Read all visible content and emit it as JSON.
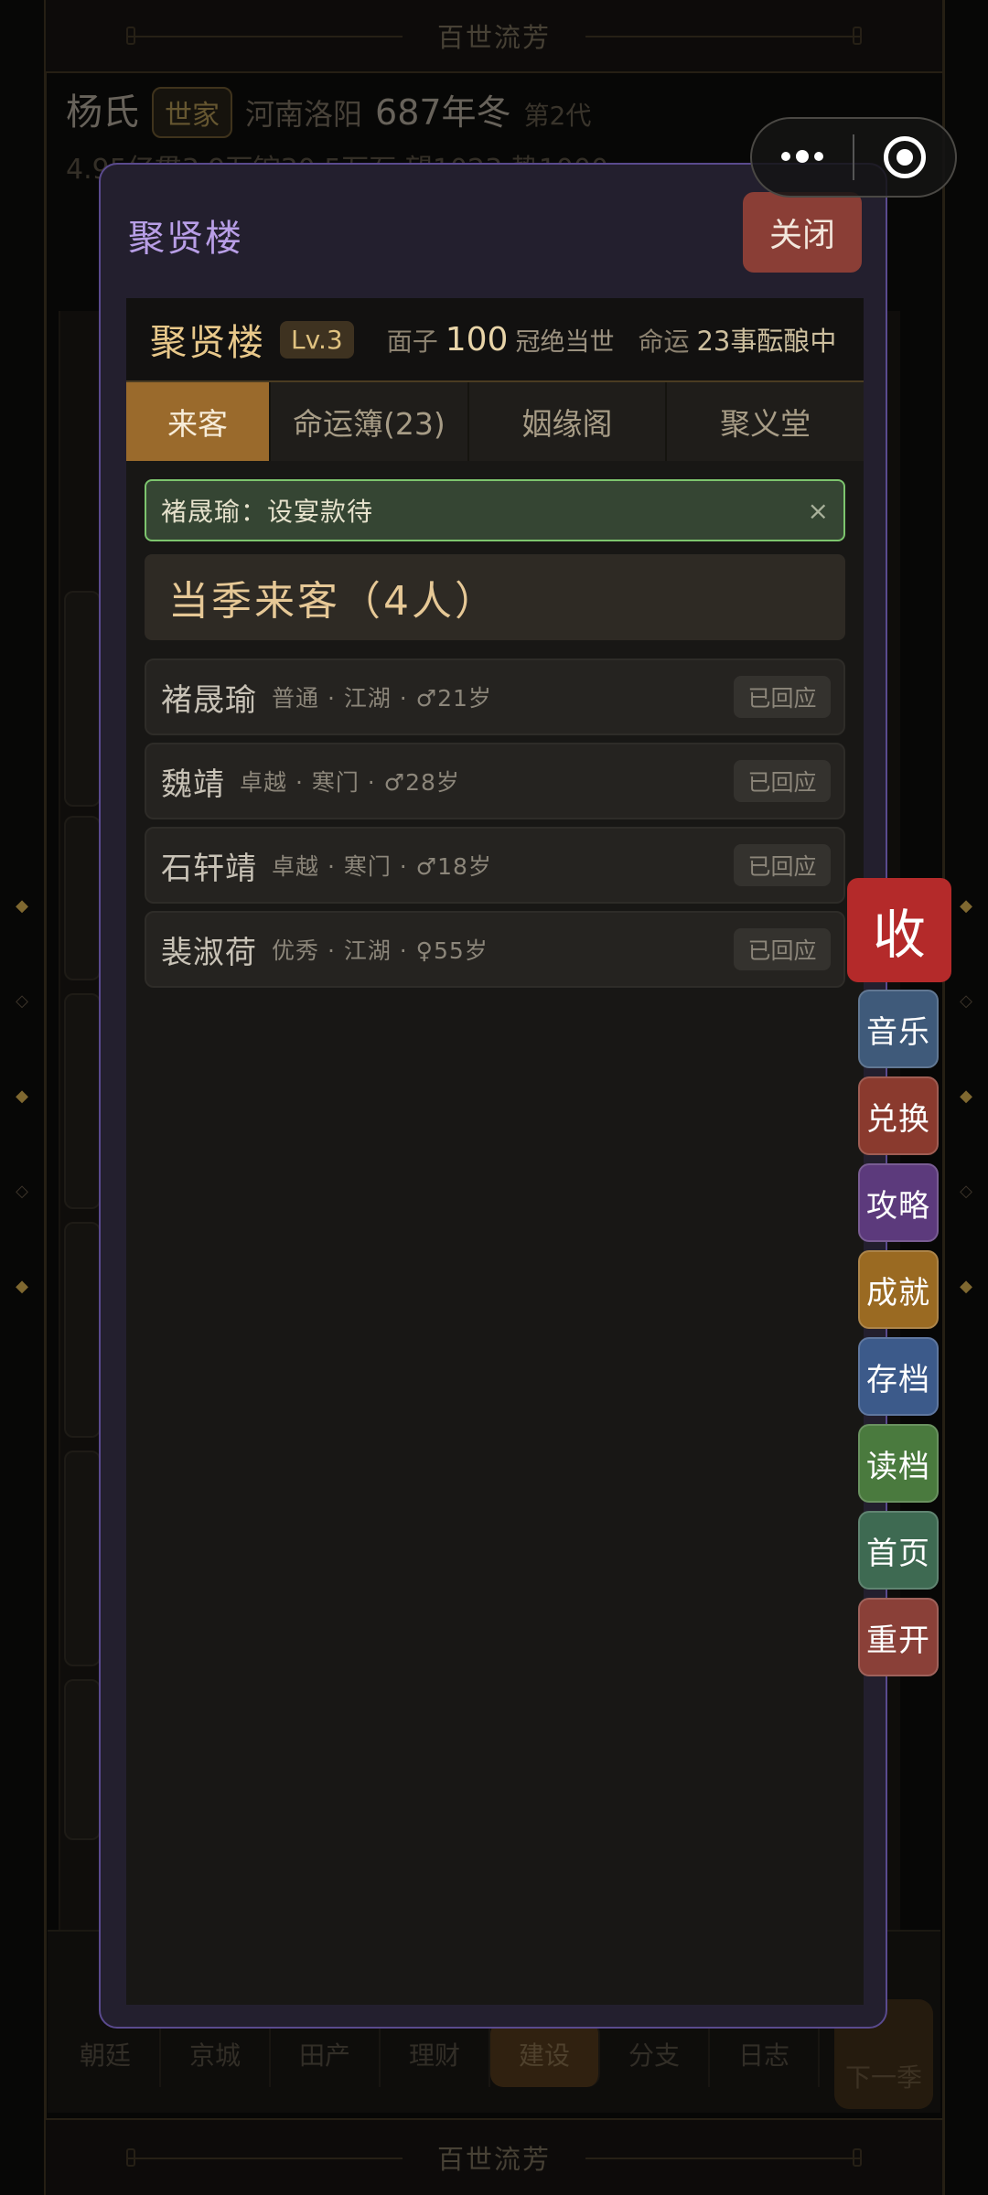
{
  "banner": {
    "title": "百世流芳"
  },
  "clan": {
    "name": "杨氏",
    "tag": "世家",
    "location": "河南洛阳",
    "year": "687年冬",
    "generation": "第2代",
    "resources": "4.95亿贯3.9万锭30.5万石 望1023 势1000"
  },
  "background": {
    "tabs": [
      "朝廷",
      "京城",
      "田产",
      "理财",
      "建设",
      "分支",
      "日志"
    ],
    "active_tab": "建设",
    "next_season": "下一季"
  },
  "modal": {
    "title": "聚贤楼",
    "close_label": "关闭",
    "building": {
      "name": "聚贤楼",
      "level": "Lv.3",
      "face_label": "面子",
      "face_value": "100",
      "face_note": "冠绝当世",
      "fate_label": "命运",
      "fate_note": "23事酝酿中"
    },
    "tabs": [
      {
        "label": "来客"
      },
      {
        "label": "命运簿(23)"
      },
      {
        "label": "姻缘阁"
      },
      {
        "label": "聚义堂"
      }
    ],
    "toast": {
      "text": "褚晟瑜：设宴款待",
      "close": "×"
    },
    "section_title": "当季来客（4人）",
    "guests": [
      {
        "name": "褚晟瑜",
        "meta": "普通 · 江湖 · ♂21岁",
        "status": "已回应"
      },
      {
        "name": "魏靖",
        "meta": "卓越 · 寒门 · ♂28岁",
        "status": "已回应"
      },
      {
        "name": "石轩靖",
        "meta": "卓越 · 寒门 · ♂18岁",
        "status": "已回应"
      },
      {
        "name": "裴淑荷",
        "meta": "优秀 · 江湖 · ♀55岁",
        "status": "已回应"
      }
    ]
  },
  "side_menu": {
    "collect": "收",
    "items": [
      {
        "label": "音乐",
        "color": "#3f5a7a"
      },
      {
        "label": "兑换",
        "color": "#8a3a2e"
      },
      {
        "label": "攻略",
        "color": "#5c3a7c"
      },
      {
        "label": "成就",
        "color": "#9a6a22"
      },
      {
        "label": "存档",
        "color": "#3c5a8a"
      },
      {
        "label": "读档",
        "color": "#4a7a3e"
      },
      {
        "label": "首页",
        "color": "#3e6a52"
      },
      {
        "label": "重开",
        "color": "#8a4038"
      }
    ]
  }
}
